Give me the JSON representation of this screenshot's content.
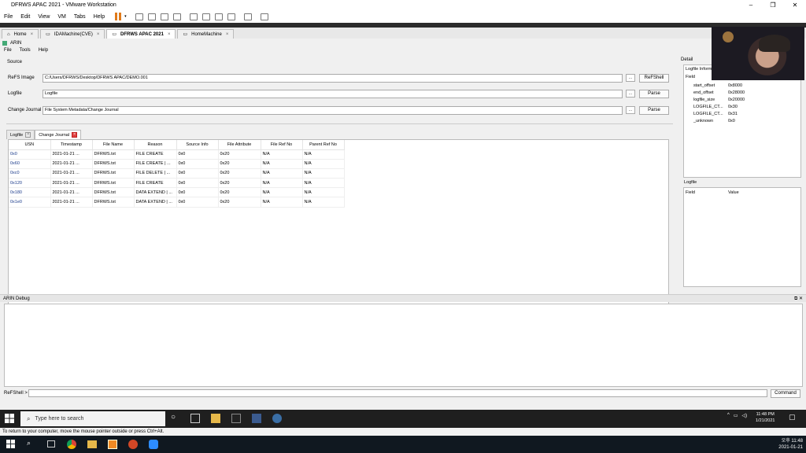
{
  "vmware": {
    "window_title": "DFRWS APAC 2021 - VMware Workstation",
    "menu": [
      "File",
      "Edit",
      "View",
      "VM",
      "Tabs",
      "Help"
    ],
    "tabs": [
      {
        "label": "Home",
        "active": false
      },
      {
        "label": "IDAMachine(CVE)",
        "active": false
      },
      {
        "label": "DFRWS APAC 2021",
        "active": true
      },
      {
        "label": "HomeMachine",
        "active": false
      }
    ],
    "status_text": "To return to your computer, move the mouse pointer outside or press Ctrl+Alt."
  },
  "app": {
    "title": "ARIN",
    "menu": [
      "File",
      "Tools",
      "Help"
    ],
    "source": {
      "label": "Source",
      "refs_image": {
        "label": "ReFS Image",
        "value": "C:/Users/DFRWS/Desktop/DFRWS APAC/DEMO.001",
        "button": "ReFShell"
      },
      "logfile": {
        "label": "Logfile",
        "value": "Logfile",
        "button": "Parse"
      },
      "change_journal": {
        "label": "Change Journal",
        "value": "File System Metadata/Change Journal",
        "button": "Parse"
      },
      "browse": "..."
    },
    "inner_tabs": [
      {
        "label": "Logfile",
        "active": false
      },
      {
        "label": "Change Journal",
        "active": true
      }
    ],
    "table": {
      "columns": [
        "USN",
        "Timestamp",
        "File Name",
        "Reason",
        "Source Info",
        "File Attribute",
        "File Ref No",
        "Parent Ref No"
      ],
      "rows": [
        [
          "0x0",
          "2021-01-21 ...",
          "DFRWS.txt",
          "FILE CREATE",
          "0x0",
          "0x20",
          "N/A",
          "N/A"
        ],
        [
          "0x60",
          "2021-01-21 ...",
          "DFRWS.txt",
          "FILE CREATE | ...",
          "0x0",
          "0x20",
          "N/A",
          "N/A"
        ],
        [
          "0xc0",
          "2021-01-21 ...",
          "DFRWS.txt",
          "FILE DELETE | ...",
          "0x0",
          "0x20",
          "N/A",
          "N/A"
        ],
        [
          "0x120",
          "2021-01-21 ...",
          "DFRWS.txt",
          "FILE CREATE",
          "0x0",
          "0x20",
          "N/A",
          "N/A"
        ],
        [
          "0x180",
          "2021-01-21 ...",
          "DFRWS.txt",
          "DATA EXTEND | ...",
          "0x0",
          "0x20",
          "N/A",
          "N/A"
        ],
        [
          "0x1e0",
          "2021-01-21 ...",
          "DFRWS.txt",
          "DATA EXTEND | ...",
          "0x0",
          "0x20",
          "N/A",
          "N/A"
        ]
      ]
    },
    "detail": {
      "label": "Detail",
      "info_panel_title": "Logfile Informa",
      "field_header": "Field",
      "value_header": "Value",
      "info": [
        {
          "field": "start_offset",
          "value": "0x8000"
        },
        {
          "field": "end_offset",
          "value": "0x28000"
        },
        {
          "field": "logfile_size",
          "value": "0x20000"
        },
        {
          "field": "LOGFILE_CT...",
          "value": "0x30"
        },
        {
          "field": "LOGFILE_CT...",
          "value": "0x31"
        },
        {
          "field": "_unknown",
          "value": "0x0"
        }
      ],
      "logfile_panel_title": "Logfile"
    },
    "debug": {
      "label": "ARIN Debug"
    },
    "refshell": {
      "label": "ReFShell >",
      "value": "",
      "button": "Command"
    }
  },
  "guest_taskbar": {
    "search_placeholder": "Type here to search",
    "time": "11:48 PM",
    "date": "1/21/2021"
  },
  "host_taskbar": {
    "time": "오후 11:48",
    "date": "2021-01-21"
  }
}
